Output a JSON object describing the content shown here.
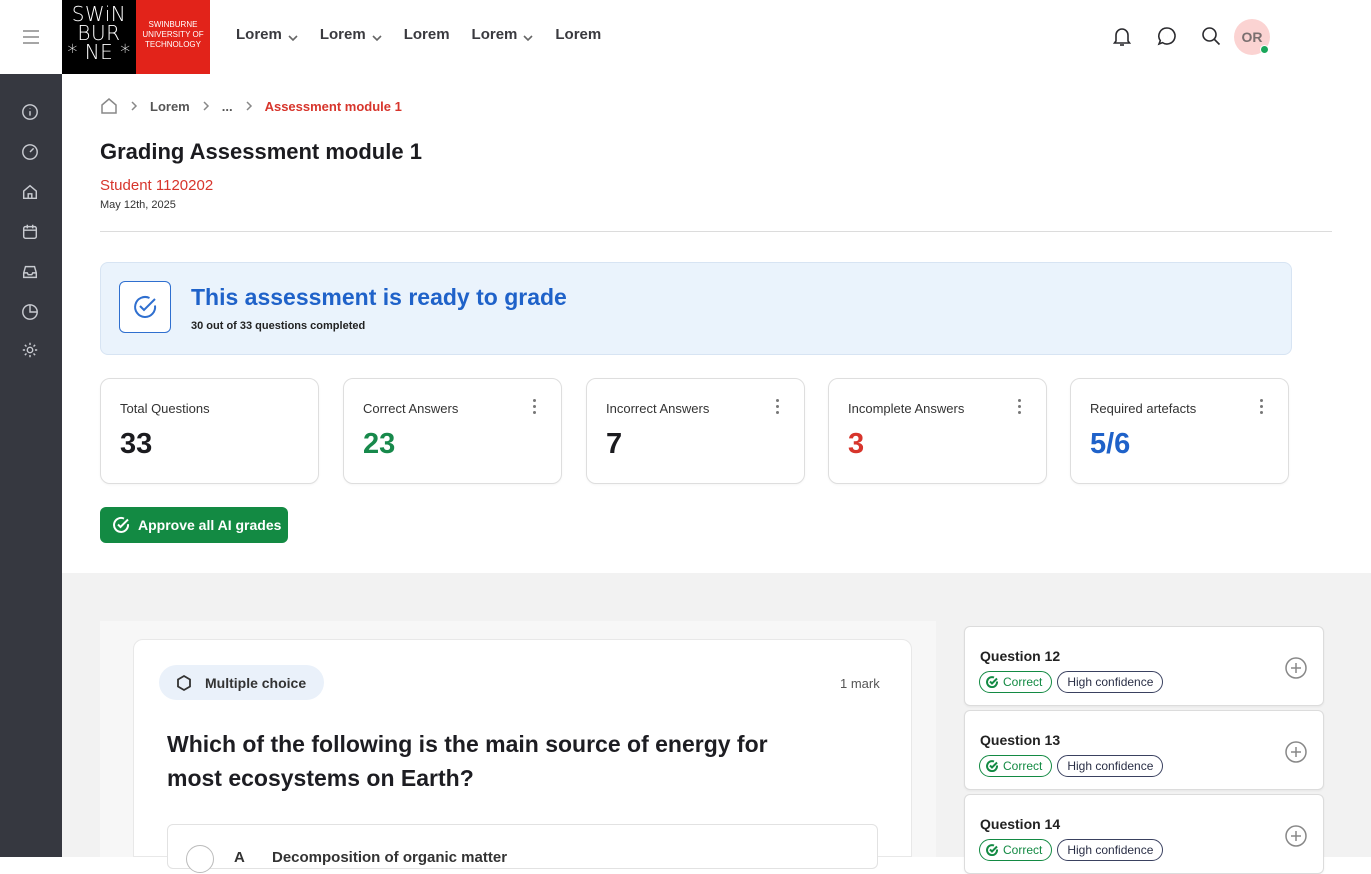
{
  "logo": {
    "mark_lines": [
      "SWiN",
      "BUR",
      "* NE *"
    ],
    "name_lines": [
      "SWINBURNE",
      "UNIVERSITY OF",
      "TECHNOLOGY"
    ]
  },
  "topnav": {
    "items": [
      {
        "label": "Lorem",
        "has_dropdown": true
      },
      {
        "label": "Lorem",
        "has_dropdown": true
      },
      {
        "label": "Lorem",
        "has_dropdown": false
      },
      {
        "label": "Lorem",
        "has_dropdown": true
      },
      {
        "label": "Lorem",
        "has_dropdown": false
      }
    ]
  },
  "user": {
    "initials": "OR",
    "status_color": "#1aa65a"
  },
  "sidebar": {
    "icons": [
      "info-icon",
      "dashboard-icon",
      "home-icon",
      "calendar-icon",
      "inbox-icon",
      "pie-chart-icon",
      "settings-icon"
    ]
  },
  "breadcrumb": {
    "items": [
      "Lorem",
      "...",
      "Assessment module 1"
    ]
  },
  "page": {
    "title": "Grading Assessment module 1",
    "student": "Student 1120202",
    "date": "May 12th, 2025"
  },
  "banner": {
    "title": "This assessment is ready to grade",
    "subtitle": "30 out of 33 questions completed"
  },
  "stats": [
    {
      "label": "Total Questions",
      "value": "33",
      "color": "#1b1b1f",
      "menu": false
    },
    {
      "label": "Correct Answers",
      "value": "23",
      "color": "#17894b",
      "menu": true
    },
    {
      "label": "Incorrect Answers",
      "value": "7",
      "color": "#1b1b1f",
      "menu": true
    },
    {
      "label": "Incomplete Answers",
      "value": "3",
      "color": "#d7352c",
      "menu": true
    },
    {
      "label": "Required artefacts",
      "value": "5/6",
      "color": "#1f62c9",
      "menu": true
    }
  ],
  "approve_button": {
    "label": "Approve all AI grades"
  },
  "question": {
    "type": "Multiple choice",
    "mark": "1 mark",
    "text": "Which of the following is the main source of energy for most ecosystems on Earth?",
    "option": {
      "letter": "A",
      "text": "Decomposition of organic matter"
    }
  },
  "question_list": [
    {
      "title": "Question 12",
      "status": "Correct",
      "confidence": "High confidence"
    },
    {
      "title": "Question 13",
      "status": "Correct",
      "confidence": "High confidence"
    },
    {
      "title": "Question 14",
      "status": "Correct",
      "confidence": "High confidence"
    }
  ],
  "colors": {
    "accent_red": "#d7352c",
    "accent_blue": "#1f62c9",
    "accent_green": "#138a43",
    "sidebar_bg": "#363840"
  }
}
